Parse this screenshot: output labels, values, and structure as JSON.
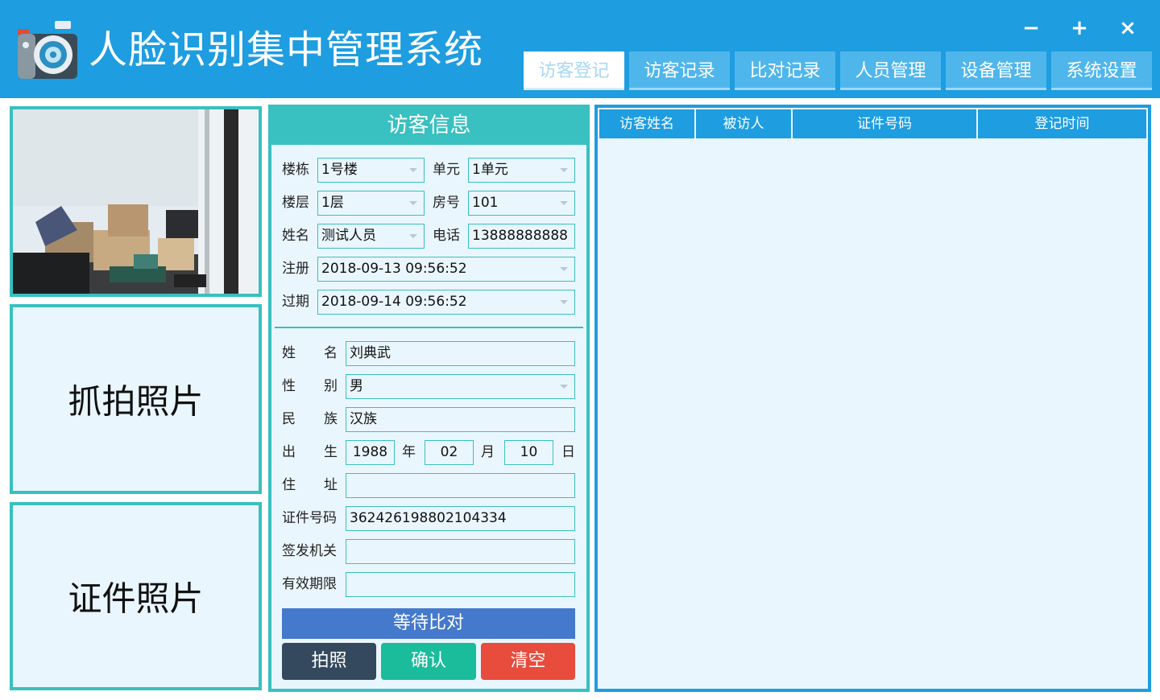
{
  "app": {
    "title": "人脸识别集中管理系统"
  },
  "window_controls": {
    "minimize": "−",
    "maximize": "+",
    "close": "×"
  },
  "tabs": [
    {
      "label": "访客登记",
      "active": true
    },
    {
      "label": "访客记录",
      "active": false
    },
    {
      "label": "比对记录",
      "active": false
    },
    {
      "label": "人员管理",
      "active": false
    },
    {
      "label": "设备管理",
      "active": false
    },
    {
      "label": "系统设置",
      "active": false
    }
  ],
  "left": {
    "capture_label": "抓拍照片",
    "id_photo_label": "证件照片"
  },
  "visitor_info": {
    "title": "访客信息",
    "building": {
      "label": "楼栋",
      "value": "1号楼"
    },
    "unit": {
      "label": "单元",
      "value": "1单元"
    },
    "floor": {
      "label": "楼层",
      "value": "1层"
    },
    "room": {
      "label": "房号",
      "value": "101"
    },
    "name": {
      "label": "姓名",
      "value": "测试人员"
    },
    "phone": {
      "label": "电话",
      "value": "13888888888"
    },
    "register": {
      "label": "注册",
      "value": "2018-09-13 09:56:52"
    },
    "expire": {
      "label": "过期",
      "value": "2018-09-14 09:56:52"
    }
  },
  "id_card": {
    "name": {
      "label_a": "姓",
      "label_b": "名",
      "value": "刘典武"
    },
    "gender": {
      "label_a": "性",
      "label_b": "别",
      "value": "男"
    },
    "ethnicity": {
      "label_a": "民",
      "label_b": "族",
      "value": "汉族"
    },
    "birth": {
      "label_a": "出",
      "label_b": "生",
      "year": "1988",
      "year_unit": "年",
      "month": "02",
      "month_unit": "月",
      "day": "10",
      "day_unit": "日"
    },
    "address": {
      "label_a": "住",
      "label_b": "址",
      "value": ""
    },
    "id_number": {
      "label": "证件号码",
      "value": "362426198802104334"
    },
    "issuer": {
      "label": "签发机关",
      "value": ""
    },
    "validity": {
      "label": "有效期限",
      "value": ""
    }
  },
  "status": "等待比对",
  "actions": {
    "photo": "拍照",
    "confirm": "确认",
    "clear": "清空"
  },
  "colors": {
    "header_blue": "#1e9de0",
    "teal": "#39c0c0",
    "status_blue": "#4479cc",
    "photo_btn": "#34495e",
    "confirm_btn": "#1abc9c",
    "clear_btn": "#e74c3c"
  },
  "records_table": {
    "columns": [
      "访客姓名",
      "被访人",
      "证件号码",
      "登记时间"
    ],
    "rows": []
  }
}
